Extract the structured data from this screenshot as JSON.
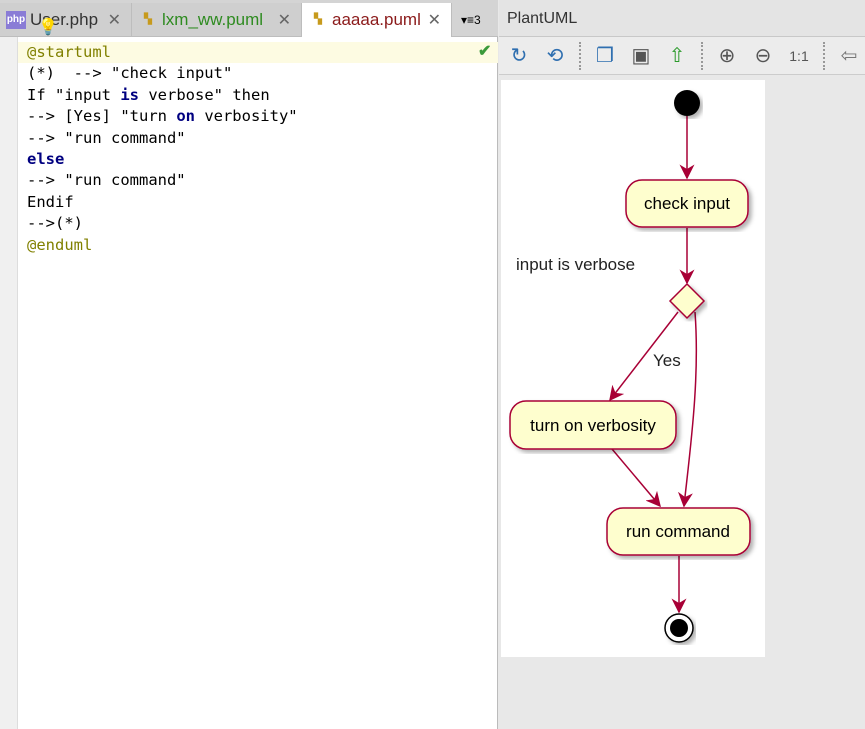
{
  "tabs": [
    {
      "label": "User.php",
      "icon": "php-file-icon",
      "color": "#333333"
    },
    {
      "label": "lxm_ww.puml",
      "icon": "puml-file-icon",
      "color": "#2e8b20"
    },
    {
      "label": "aaaaa.puml",
      "icon": "puml-file-icon",
      "color": "#8b1a1a",
      "active": true
    }
  ],
  "tab_overflow": "3",
  "code": [
    "@startuml",
    "(*)  --> \"check input\"",
    "If \"input is verbose\" then",
    "--> [Yes] \"turn on verbosity\"",
    "--> \"run command\"",
    "else",
    "--> \"run command\"",
    "Endif",
    "-->(*)",
    "@enduml"
  ],
  "panel_title": "PlantUML",
  "toolbar": [
    "refresh-icon",
    "auto-refresh-icon",
    "copy-icon",
    "save-icon",
    "export-icon",
    "zoom-in-icon",
    "zoom-out-icon",
    "zoom-actual-icon",
    "back-icon"
  ],
  "diagram": {
    "check": "check input",
    "condition": "input is verbose",
    "yes": "Yes",
    "turn_on": "turn on verbosity",
    "run": "run command",
    "box_fill": "#fefece",
    "border": "#a80036"
  }
}
